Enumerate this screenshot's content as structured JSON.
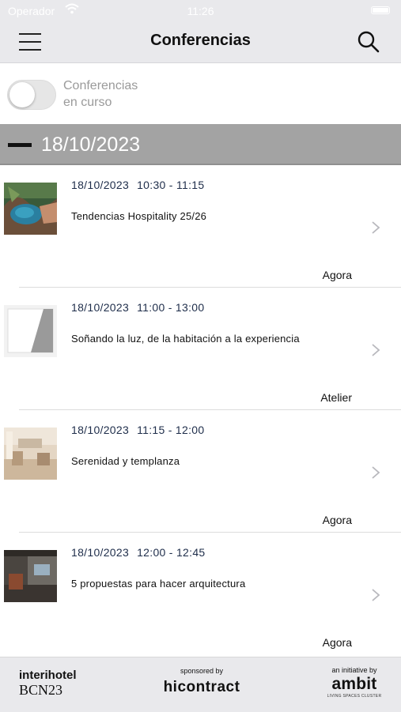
{
  "status_bar": {
    "carrier": "Operador",
    "time": "11:26"
  },
  "header": {
    "title": "Conferencias"
  },
  "toggle": {
    "label_line1": "Conferencias",
    "label_line2": "en curso",
    "on": false
  },
  "date_group": {
    "date": "18/10/2023"
  },
  "conferences": [
    {
      "date": "18/10/2023",
      "time": "10:30 - 11:15",
      "title": "Tendencias Hospitality 25/26",
      "room": "Agora"
    },
    {
      "date": "18/10/2023",
      "time": "11:00 - 13:00",
      "title": "Soñando la luz, de la habitación a la experiencia",
      "room": "Atelier"
    },
    {
      "date": "18/10/2023",
      "time": "11:15 - 12:00",
      "title": "Serenidad y templanza",
      "room": "Agora"
    },
    {
      "date": "18/10/2023",
      "time": "12:00 - 12:45",
      "title": "5 propuestas para hacer arquitectura",
      "room": "Agora"
    }
  ],
  "footer": {
    "event_name": "interihotel",
    "event_edition": "BCN23",
    "sponsor_label": "sponsored by",
    "sponsor_name": "hicontract",
    "initiative_label": "an initiative by",
    "initiative_name": "ambit",
    "initiative_tagline": "LIVING SPACES CLUSTER"
  }
}
